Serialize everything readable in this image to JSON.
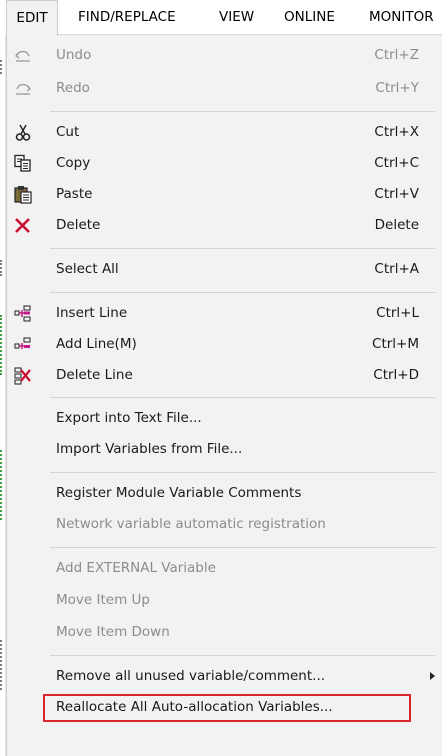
{
  "menubar": {
    "items": [
      {
        "label": "EDIT",
        "active": true
      },
      {
        "label": "FIND/REPLACE"
      },
      {
        "label": "VIEW"
      },
      {
        "label": "ONLINE"
      },
      {
        "label": "MONITOR"
      }
    ]
  },
  "menu": {
    "undo": {
      "label": "Undo",
      "shortcut": "Ctrl+Z",
      "enabled": false,
      "icon": "undo-icon"
    },
    "redo": {
      "label": "Redo",
      "shortcut": "Ctrl+Y",
      "enabled": false,
      "icon": "redo-icon"
    },
    "cut": {
      "label": "Cut",
      "shortcut": "Ctrl+X",
      "icon": "scissors-icon"
    },
    "copy": {
      "label": "Copy",
      "shortcut": "Ctrl+C",
      "icon": "copy-icon"
    },
    "paste": {
      "label": "Paste",
      "shortcut": "Ctrl+V",
      "icon": "paste-icon"
    },
    "delete": {
      "label": "Delete",
      "shortcut": "Delete",
      "icon": "delete-x-icon"
    },
    "select_all": {
      "label": "Select All",
      "shortcut": "Ctrl+A"
    },
    "insert_line": {
      "label": "Insert Line",
      "shortcut": "Ctrl+L",
      "icon": "insert-line-icon"
    },
    "add_line": {
      "label": "Add Line(M)",
      "shortcut": "Ctrl+M",
      "icon": "add-line-icon"
    },
    "delete_line": {
      "label": "Delete Line",
      "shortcut": "Ctrl+D",
      "icon": "delete-line-icon"
    },
    "export_text": {
      "label": "Export into Text File..."
    },
    "import_vars": {
      "label": "Import Variables from File..."
    },
    "register_comments": {
      "label": "Register Module Variable Comments"
    },
    "network_auto_reg": {
      "label": "Network variable automatic registration",
      "enabled": false
    },
    "add_external": {
      "label": "Add EXTERNAL Variable",
      "enabled": false
    },
    "move_up": {
      "label": "Move Item Up",
      "enabled": false
    },
    "move_down": {
      "label": "Move Item Down",
      "enabled": false
    },
    "remove_unused": {
      "label": "Remove all unused variable/comment...",
      "has_submenu": true
    },
    "reallocate": {
      "label": "Reallocate All Auto-allocation Variables...",
      "highlighted": true
    }
  },
  "colors": {
    "menu_bg": "#f2f2f2",
    "disabled_text": "#8c8c8c",
    "highlight_border": "#d9262b",
    "delete_x": "#c8102e"
  }
}
